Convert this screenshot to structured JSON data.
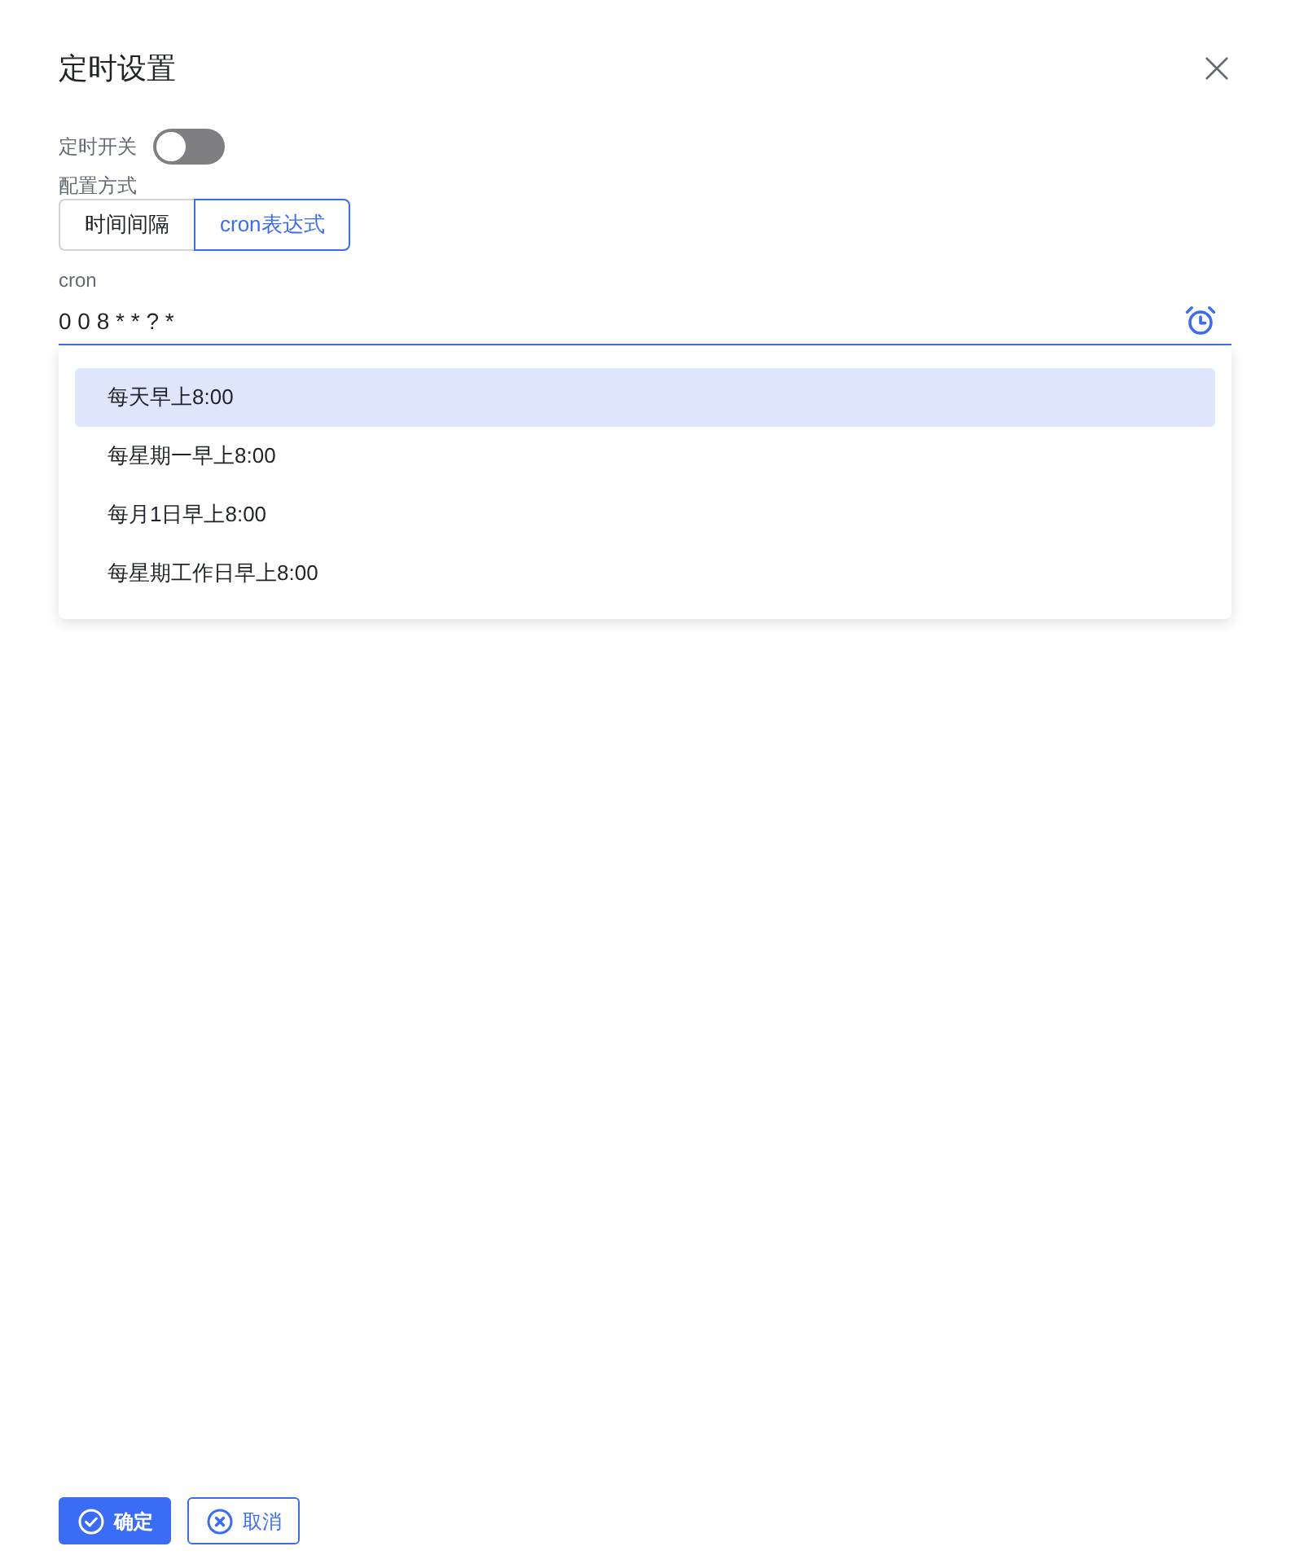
{
  "dialog": {
    "title": "定时设置"
  },
  "schedule_switch": {
    "label": "定时开关",
    "on": false
  },
  "config_mode": {
    "label": "配置方式",
    "options": [
      {
        "label": "时间间隔",
        "selected": false
      },
      {
        "label": "cron表达式",
        "selected": true
      }
    ]
  },
  "cron": {
    "label": "cron",
    "value": "0 0 8 * * ? *",
    "suggestions": [
      {
        "label": "每天早上8:00",
        "selected": true
      },
      {
        "label": "每星期一早上8:00",
        "selected": false
      },
      {
        "label": "每月1日早上8:00",
        "selected": false
      },
      {
        "label": "每星期工作日早上8:00",
        "selected": false
      }
    ]
  },
  "buttons": [
    {
      "kind": "primary",
      "label": "确定"
    },
    {
      "kind": "secondary",
      "label": "取消"
    }
  ]
}
